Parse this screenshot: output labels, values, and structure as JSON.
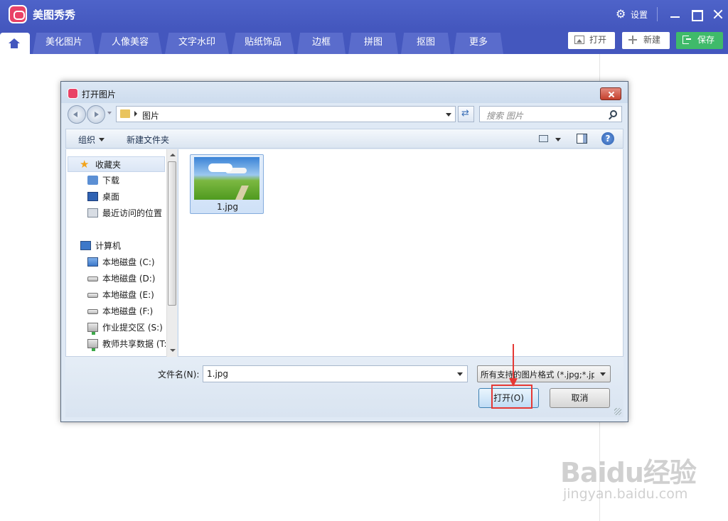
{
  "app": {
    "name": "美图秀秀",
    "settings_label": "设置",
    "tabs": [
      "美化图片",
      "人像美容",
      "文字水印",
      "贴纸饰品",
      "边框",
      "拼图",
      "抠图",
      "更多"
    ],
    "toolbar": {
      "open_label": "打开",
      "new_label": "新建",
      "save_label": "保存"
    },
    "colors": {
      "primary": "#4457be",
      "save": "#3fba6a",
      "logo": "#e94266"
    }
  },
  "dialog": {
    "title": "打开图片",
    "address": {
      "path": "图片"
    },
    "search": {
      "placeholder": "搜索 图片"
    },
    "commands": {
      "organize": "组织",
      "new_folder": "新建文件夹"
    },
    "nav": {
      "favorites_label": "收藏夹",
      "favorites": [
        "下载",
        "桌面",
        "最近访问的位置"
      ],
      "computer_label": "计算机",
      "drives": [
        "本地磁盘 (C:)",
        "本地磁盘 (D:)",
        "本地磁盘 (E:)",
        "本地磁盘 (F:)",
        "作业提交区 (S:)",
        "教师共享数据 (T:"
      ]
    },
    "files": [
      {
        "name": "1.jpg"
      }
    ],
    "filename_label": "文件名(N):",
    "filename_value": "1.jpg",
    "filetype": "所有支持的图片格式 (*.jpg;*.jp",
    "open_button": "打开(O)",
    "cancel_button": "取消"
  },
  "watermark": {
    "main": "Baidu经验",
    "sub": "jingyan.baidu.com"
  }
}
